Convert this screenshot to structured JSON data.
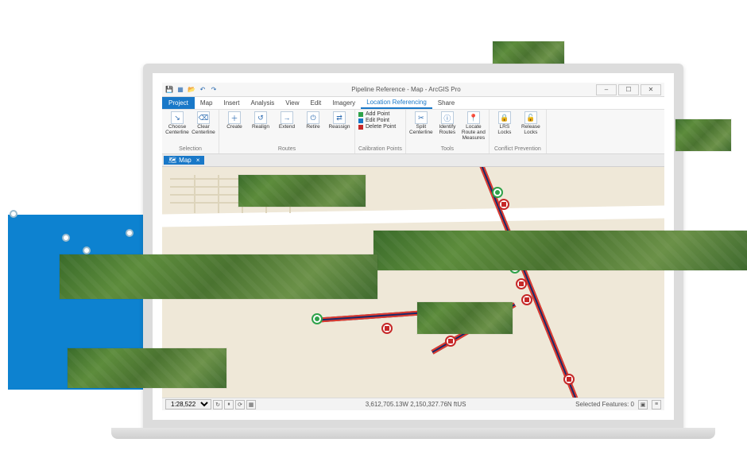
{
  "app_title": "Pipeline Reference - Map - ArcGIS Pro",
  "quick_access": [
    "save-icon",
    "new-icon",
    "open-icon",
    "undo-icon",
    "redo-icon"
  ],
  "window_buttons": {
    "min": "–",
    "max": "☐",
    "close": "✕"
  },
  "menu": {
    "project_label": "Project",
    "tabs": [
      {
        "label": "Map"
      },
      {
        "label": "Insert"
      },
      {
        "label": "Analysis"
      },
      {
        "label": "View"
      },
      {
        "label": "Edit"
      },
      {
        "label": "Imagery"
      },
      {
        "label": "Location Referencing",
        "active": true
      },
      {
        "label": "Share"
      }
    ]
  },
  "ribbon": {
    "groups": [
      {
        "name": "Selection",
        "buttons": [
          {
            "id": "choose-centerline",
            "label": "Choose\nCenterline",
            "icon": "↳"
          },
          {
            "id": "clear-centerline",
            "label": "Clear\nCenterline",
            "icon": "⌫"
          }
        ]
      },
      {
        "name": "Routes",
        "buttons": [
          {
            "id": "create",
            "label": "Create",
            "icon": "＋"
          },
          {
            "id": "realign",
            "label": "Realign",
            "icon": "↺"
          },
          {
            "id": "extend",
            "label": "Extend",
            "icon": "→"
          },
          {
            "id": "retire",
            "label": "Retire",
            "icon": "⏻"
          },
          {
            "id": "reassign",
            "label": "Reassign",
            "icon": "⇄"
          }
        ]
      },
      {
        "name": "Calibration Points",
        "list": [
          {
            "label": "Add Point",
            "color": "#2fa24a"
          },
          {
            "label": "Edit Point",
            "color": "#1978c8"
          },
          {
            "label": "Delete Point",
            "color": "#c62828"
          }
        ]
      },
      {
        "name": "Tools",
        "buttons": [
          {
            "id": "split-centerline",
            "label": "Split\nCenterline",
            "icon": "✂"
          },
          {
            "id": "identify-routes",
            "label": "Identify\nRoutes",
            "icon": "ⓘ"
          },
          {
            "id": "locate-route-measures",
            "label": "Locate Route\nand Measures",
            "icon": "📍"
          }
        ]
      },
      {
        "name": "Conflict Prevention",
        "buttons": [
          {
            "id": "lrs-locks",
            "label": "LRS\nLocks",
            "icon": "🔒"
          },
          {
            "id": "release-locks",
            "label": "Release\nLocks",
            "icon": "🔓"
          }
        ]
      }
    ]
  },
  "map_tab_label": "Map",
  "status": {
    "scale_value": "1:28,522",
    "coordinates": "3,612,705.13W 2,150,327.76N ftUS",
    "selected_features_label": "Selected Features: 0"
  },
  "colors": {
    "accent": "#1978c8",
    "pipe_blue": "#1a2a6b",
    "pipe_red": "#e03b2e",
    "basemap": "#efe8d8"
  }
}
